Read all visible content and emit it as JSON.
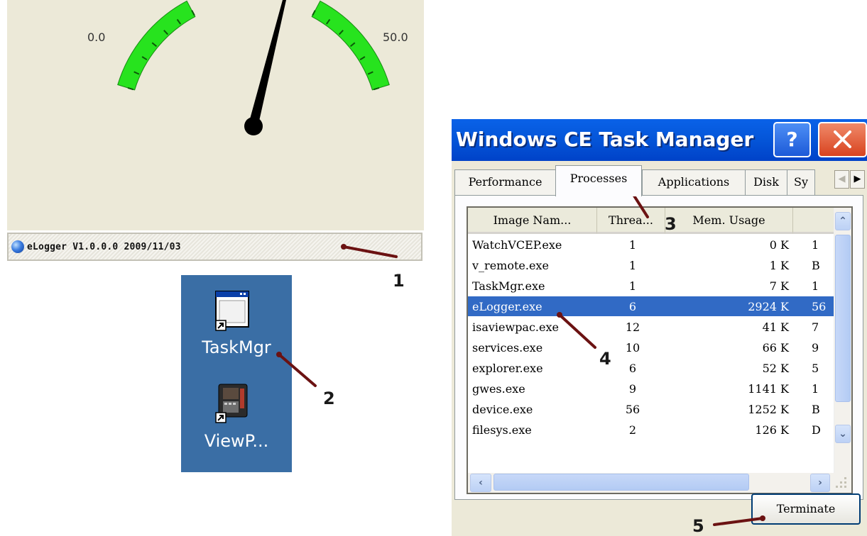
{
  "gauge": {
    "min_label": "0.0",
    "max_label": "50.0",
    "band_color": "#27e31e",
    "needle_color": "#000000"
  },
  "status_bar": {
    "icon": "globe-icon",
    "text": "eLogger V1.0.0.0 2009/11/03"
  },
  "desktop": {
    "background": "#3a6ea5",
    "icons": [
      {
        "label": "TaskMgr",
        "icon": "window-app-icon"
      },
      {
        "label": "ViewP...",
        "icon": "device-panel-icon"
      }
    ]
  },
  "task_manager": {
    "title": "Windows CE Task Manager",
    "help_label": "?",
    "tabs": [
      "Performance",
      "Processes",
      "Applications",
      "Disk",
      "Sy"
    ],
    "active_tab": "Processes",
    "columns": [
      "Image Nam...",
      "Threa...",
      "Mem. Usage"
    ],
    "rows": [
      {
        "name": "WatchVCEP.exe",
        "threads": "1",
        "mem": "0 K",
        "extra": "1"
      },
      {
        "name": "v_remote.exe",
        "threads": "1",
        "mem": "1 K",
        "extra": "B"
      },
      {
        "name": "TaskMgr.exe",
        "threads": "1",
        "mem": "7 K",
        "extra": "1"
      },
      {
        "name": "eLogger.exe",
        "threads": "6",
        "mem": "2924 K",
        "extra": "56"
      },
      {
        "name": "isaviewpac.exe",
        "threads": "12",
        "mem": "41 K",
        "extra": "7"
      },
      {
        "name": "services.exe",
        "threads": "10",
        "mem": "66 K",
        "extra": "9"
      },
      {
        "name": "explorer.exe",
        "threads": "6",
        "mem": "52 K",
        "extra": "5"
      },
      {
        "name": "gwes.exe",
        "threads": "9",
        "mem": "1141 K",
        "extra": "1"
      },
      {
        "name": "device.exe",
        "threads": "56",
        "mem": "1252 K",
        "extra": "B"
      },
      {
        "name": "filesys.exe",
        "threads": "2",
        "mem": "126 K",
        "extra": "D"
      }
    ],
    "selected_row": "eLogger.exe",
    "terminate_label": "Terminate",
    "accent_color": "#0455d8",
    "selection_color": "#316ac5"
  },
  "annotations": [
    "1",
    "2",
    "3",
    "4",
    "5"
  ]
}
